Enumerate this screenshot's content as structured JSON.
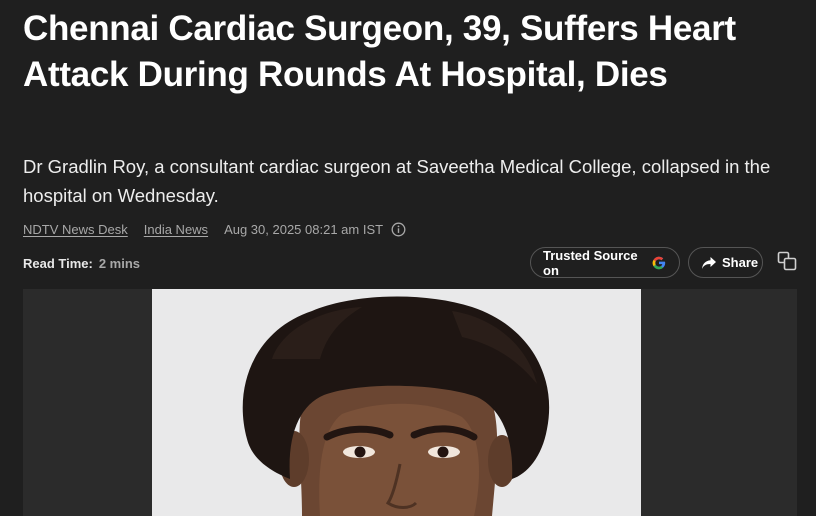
{
  "article": {
    "headline": "Chennai Cardiac Surgeon, 39, Suffers Heart Attack During Rounds At Hospital, Dies",
    "summary": "Dr Gradlin Roy, a consultant cardiac surgeon at Saveetha Medical College, collapsed in the hospital on Wednesday.",
    "byline": {
      "author": "NDTV News Desk",
      "category": "India News",
      "date": "Aug 30, 2025 08:21 am IST",
      "info_icon": "info-icon"
    },
    "read_time": {
      "label": "Read Time:",
      "value": "2 mins"
    },
    "actions": {
      "trusted_source": "Trusted Source on",
      "trusted_icon": "google-g-icon",
      "share": "Share",
      "share_icon": "share-arrow-icon",
      "copy_icon": "copy-icon"
    },
    "image": {
      "subject": "portrait-photo"
    }
  },
  "colors": {
    "background": "#1f1f1f",
    "text": "#ffffff",
    "muted": "#a8a8a8",
    "photo_bg": "#e9e9ea"
  }
}
